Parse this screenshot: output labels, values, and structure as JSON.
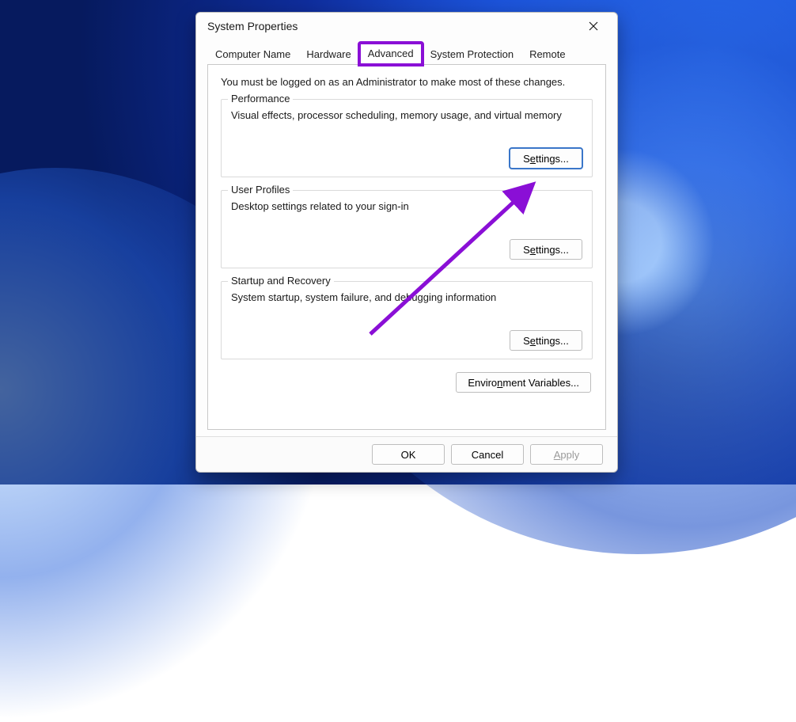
{
  "dialog": {
    "title": "System Properties",
    "tabs": [
      {
        "label": "Computer Name",
        "active": false
      },
      {
        "label": "Hardware",
        "active": false
      },
      {
        "label": "Advanced",
        "active": true
      },
      {
        "label": "System Protection",
        "active": false
      },
      {
        "label": "Remote",
        "active": false
      }
    ],
    "admin_note": "You must be logged on as an Administrator to make most of these changes.",
    "groups": {
      "performance": {
        "title": "Performance",
        "desc": "Visual effects, processor scheduling, memory usage, and virtual memory",
        "button": "Settings..."
      },
      "user_profiles": {
        "title": "User Profiles",
        "desc": "Desktop settings related to your sign-in",
        "button": "Settings..."
      },
      "startup": {
        "title": "Startup and Recovery",
        "desc": "System startup, system failure, and debugging information",
        "button": "Settings..."
      }
    },
    "env_button": "Environment Variables...",
    "buttons": {
      "ok": "OK",
      "cancel": "Cancel",
      "apply": "Apply"
    },
    "annotation": {
      "highlighted_tab": "Advanced",
      "arrow_target": "performance_settings_button",
      "color": "#8a0fd6"
    }
  }
}
